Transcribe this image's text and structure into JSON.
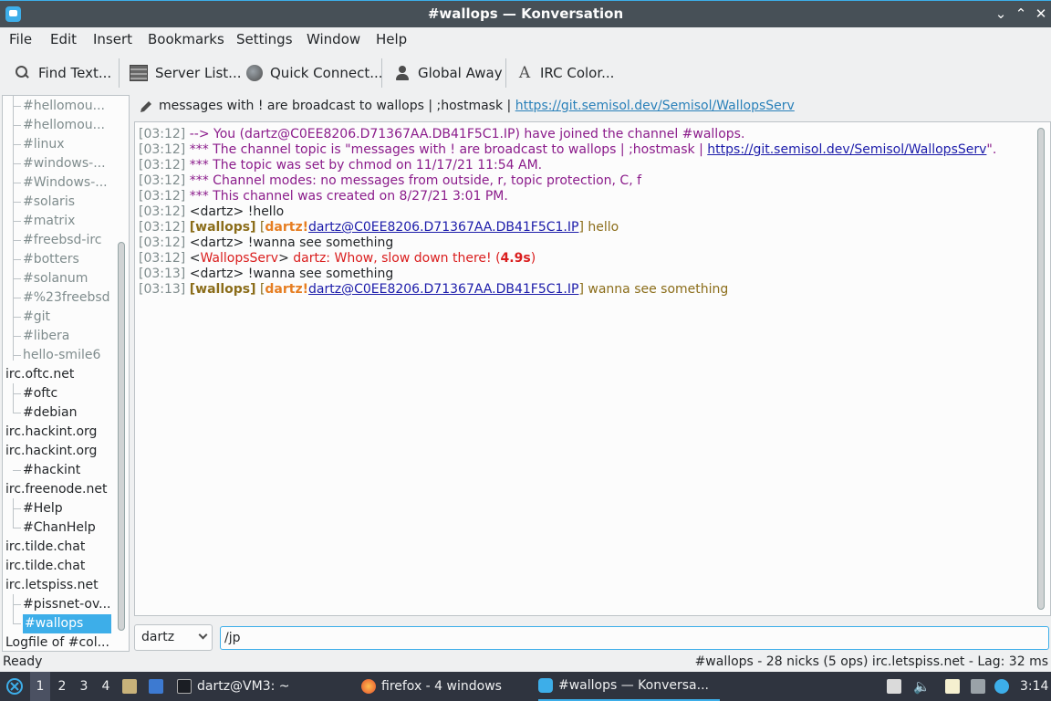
{
  "window": {
    "title": "#wallops — Konversation"
  },
  "menu": [
    "File",
    "Edit",
    "Insert",
    "Bookmarks",
    "Settings",
    "Window",
    "Help"
  ],
  "toolbar": {
    "find_text": "Find Text...",
    "server_list": "Server List...",
    "quick_connect": "Quick Connect...",
    "global_away": "Global Away",
    "irc_color": "IRC Color..."
  },
  "sidebar": {
    "items": [
      {
        "label": "#hellomou...",
        "kind": "channel",
        "state": "inactive"
      },
      {
        "label": "#hellomou...",
        "kind": "channel",
        "state": "inactive"
      },
      {
        "label": "#linux",
        "kind": "channel",
        "state": "inactive"
      },
      {
        "label": "#windows-...",
        "kind": "channel",
        "state": "inactive"
      },
      {
        "label": "#Windows-...",
        "kind": "channel",
        "state": "inactive"
      },
      {
        "label": "#solaris",
        "kind": "channel",
        "state": "inactive"
      },
      {
        "label": "#matrix",
        "kind": "channel",
        "state": "inactive"
      },
      {
        "label": "#freebsd-irc",
        "kind": "channel",
        "state": "inactive"
      },
      {
        "label": "#botters",
        "kind": "channel",
        "state": "inactive"
      },
      {
        "label": "#solanum",
        "kind": "channel",
        "state": "inactive"
      },
      {
        "label": "#%23freebsd",
        "kind": "channel",
        "state": "inactive"
      },
      {
        "label": "#git",
        "kind": "channel",
        "state": "inactive"
      },
      {
        "label": "#libera",
        "kind": "channel",
        "state": "inactive"
      },
      {
        "label": "hello-smile6",
        "kind": "channel",
        "state": "inactive"
      },
      {
        "label": "irc.oftc.net",
        "kind": "network",
        "state": "active"
      },
      {
        "label": "#oftc",
        "kind": "channel",
        "state": "active"
      },
      {
        "label": "#debian",
        "kind": "channel",
        "state": "active"
      },
      {
        "label": "irc.hackint.org",
        "kind": "network",
        "state": "active"
      },
      {
        "label": "irc.hackint.org",
        "kind": "network",
        "state": "active"
      },
      {
        "label": "#hackint",
        "kind": "channel",
        "state": "active"
      },
      {
        "label": "irc.freenode.net",
        "kind": "network",
        "state": "active"
      },
      {
        "label": "#Help",
        "kind": "channel",
        "state": "active"
      },
      {
        "label": "#ChanHelp",
        "kind": "channel",
        "state": "active"
      },
      {
        "label": "irc.tilde.chat",
        "kind": "network",
        "state": "active"
      },
      {
        "label": "irc.tilde.chat",
        "kind": "network",
        "state": "active"
      },
      {
        "label": "irc.letspiss.net",
        "kind": "network",
        "state": "active"
      },
      {
        "label": "#pissnet-ov...",
        "kind": "channel",
        "state": "active"
      },
      {
        "label": "#wallops",
        "kind": "channel",
        "state": "selected"
      },
      {
        "label": "Logfile of #col...",
        "kind": "network",
        "state": "active"
      }
    ]
  },
  "topic": {
    "text": "messages with ! are broadcast to wallops | ;hostmask | ",
    "link": "https://git.semisol.dev/Semisol/WallopsServ"
  },
  "chat": {
    "l1_ts": "[03:12]",
    "l1_msg": "--> You (dartz@C0EE8206.D71367AA.DB41F5C1.IP) have joined the channel #wallops.",
    "l2_ts": "[03:12]",
    "l2_msg": "*** The channel topic is \"messages with ! are broadcast to wallops | ;hostmask | ",
    "l2_link": "https://git.semisol.dev/Semisol/WallopsServ",
    "l2_end": "\".",
    "l3_ts": "[03:12]",
    "l3_msg": "*** The topic was set by chmod on 11/17/21 11:54 AM.",
    "l4_ts": "[03:12]",
    "l4_msg": "*** Channel modes: no messages from outside, r, topic protection, C, f",
    "l5_ts": "[03:12]",
    "l5_msg": "*** This channel was created on 8/27/21 3:01 PM.",
    "l6_ts": "[03:12]",
    "l6_msg": "<dartz> !hello",
    "l7_ts": "[03:12]",
    "l7_prefix": "[wallops]",
    "l7_open": "[",
    "l7_nick": "dartz",
    "l7_bang": "!",
    "l7_host": "dartz@C0EE8206.D71367AA.DB41F5C1.IP",
    "l7_close": "]",
    "l7_msg": " hello",
    "l8_ts": "[03:12]",
    "l8_msg": "<dartz> !wanna see something",
    "l9_ts": "[03:12]",
    "l9_open": "<",
    "l9_nick": "WallopsServ",
    "l9_close": ">",
    "l9_msg": " dartz: Whow, slow down there! (",
    "l9_time": "4.9s",
    "l9_end": ")",
    "l10_ts": "[03:13]",
    "l10_msg": "<dartz> !wanna see something",
    "l11_ts": "[03:13]",
    "l11_prefix": "[wallops]",
    "l11_open": "[",
    "l11_nick": "dartz",
    "l11_bang": "!",
    "l11_host": "dartz@C0EE8206.D71367AA.DB41F5C1.IP",
    "l11_close": "]",
    "l11_msg": " wanna see something"
  },
  "input": {
    "nick": "dartz",
    "value": "/jp"
  },
  "status": {
    "left": "Ready",
    "right": "#wallops - 28 nicks (5 ops)  irc.letspiss.net - Lag: 32 ms"
  },
  "taskbar": {
    "desktops": [
      "1",
      "2",
      "3",
      "4"
    ],
    "terminal": "dartz@VM3: ~",
    "firefox": "firefox - 4 windows",
    "konversation": "#wallops — Konversa...",
    "clock": "3:14"
  },
  "colors": {
    "accent": "#3daee9",
    "topic_link": "#2980b9",
    "join": "#8b1c8b",
    "wallops": "#8b6d1a",
    "nick": "#e67e22",
    "warn": "#da1e1e"
  }
}
